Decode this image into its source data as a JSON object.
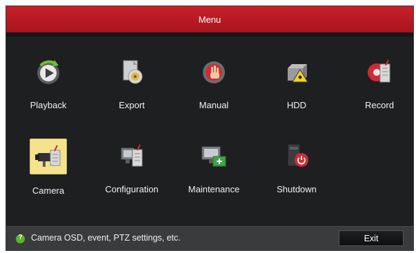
{
  "window": {
    "title": "Menu"
  },
  "menu": {
    "items": [
      {
        "label": "Playback",
        "icon": "playback-icon"
      },
      {
        "label": "Export",
        "icon": "export-icon"
      },
      {
        "label": "Manual",
        "icon": "manual-icon"
      },
      {
        "label": "HDD",
        "icon": "hdd-icon"
      },
      {
        "label": "Record",
        "icon": "record-icon"
      },
      {
        "label": "Camera",
        "icon": "camera-icon",
        "selected": true
      },
      {
        "label": "Configuration",
        "icon": "configuration-icon"
      },
      {
        "label": "Maintenance",
        "icon": "maintenance-icon"
      },
      {
        "label": "Shutdown",
        "icon": "shutdown-icon"
      }
    ]
  },
  "status": {
    "icon": "help-icon",
    "text": "Camera OSD, event, PTZ settings, etc.",
    "exit_label": "Exit"
  },
  "colors": {
    "title_bar": "#b81a23",
    "background": "#1e1f21",
    "selected_tile": "#f4e28c"
  }
}
